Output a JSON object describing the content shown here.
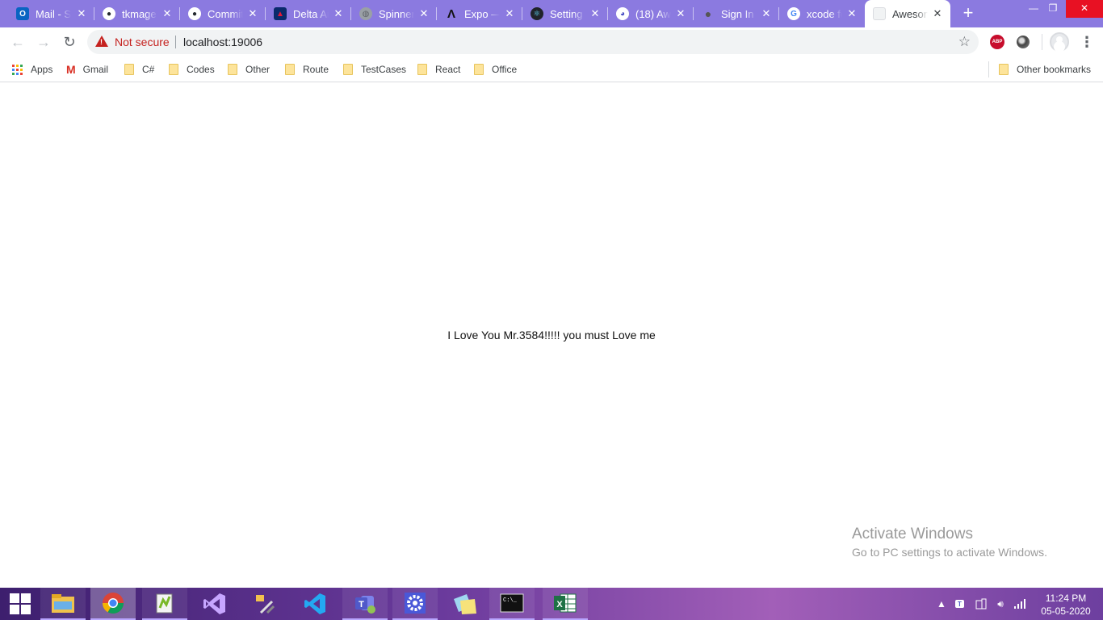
{
  "tabs": [
    {
      "title": "Mail - Sh",
      "icon": "outlook-icon",
      "color": "#0a64c2"
    },
    {
      "title": "tkmage",
      "icon": "github-icon",
      "color": "#24292e"
    },
    {
      "title": "Commit",
      "icon": "github-icon",
      "color": "#24292e"
    },
    {
      "title": "Delta Ai",
      "icon": "delta-icon",
      "color": "#0b2a6b"
    },
    {
      "title": "Spinner",
      "icon": "globe-icon",
      "color": "#5f6368"
    },
    {
      "title": "Expo —",
      "icon": "expo-icon",
      "color": "#111111"
    },
    {
      "title": "Setting",
      "icon": "react-icon",
      "color": "#20232a"
    },
    {
      "title": "(18) Aw",
      "icon": "chat-icon",
      "color": "#4a4fc4"
    },
    {
      "title": "Sign In",
      "icon": "apple-icon",
      "color": "#555555"
    },
    {
      "title": "xcode fc",
      "icon": "google-icon",
      "color": "#ffffff"
    },
    {
      "title": "Aweson",
      "icon": "blank-page-icon",
      "color": "#f1f3f4",
      "active": true
    }
  ],
  "address_bar": {
    "security_label": "Not secure",
    "url": "localhost:19006"
  },
  "bookmarks": {
    "items": [
      "Apps",
      "Gmail",
      "C#",
      "Codes",
      "Other",
      "Route",
      "TestCases",
      "React",
      "Office"
    ],
    "other": "Other bookmarks"
  },
  "page": {
    "message": "I Love You Mr.3584!!!!! you must Love me"
  },
  "watermark": {
    "title": "Activate Windows",
    "subtitle": "Go to PC settings to activate Windows."
  },
  "taskbar": {
    "apps": [
      "start-button",
      "file-explorer-icon",
      "chrome-icon",
      "notepadpp-icon",
      "visual-studio-icon",
      "tools-icon",
      "vscode-icon",
      "teams-icon",
      "settings-icon",
      "sticky-notes-icon",
      "cmd-icon",
      "excel-icon"
    ],
    "time": "11:24 PM",
    "date": "05-05-2020"
  }
}
